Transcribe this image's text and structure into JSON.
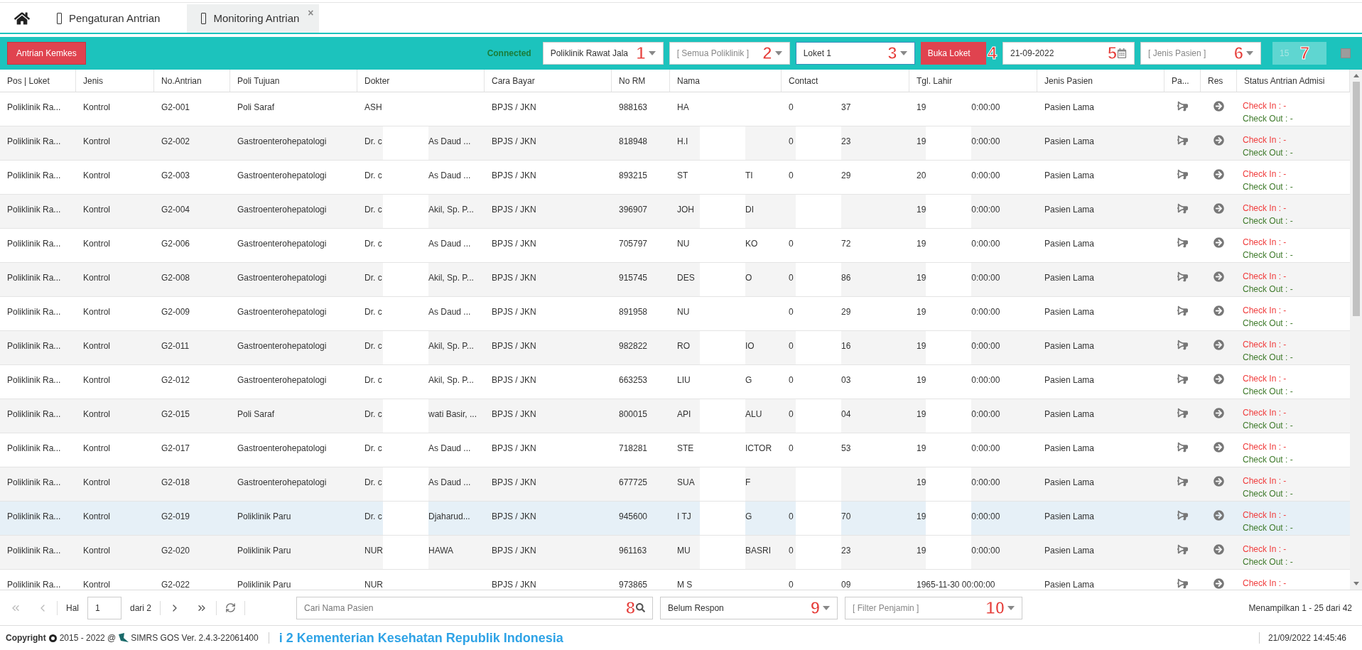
{
  "tabs": [
    {
      "kind": "home",
      "selected": false
    },
    {
      "kind": "page",
      "label": "Pengaturan Antrian",
      "selected": false
    },
    {
      "kind": "page",
      "label": "Monitoring Antrian",
      "selected": true,
      "close": "×"
    }
  ],
  "toolbar": {
    "kemkes_button": "Antrian Kemkes",
    "status": "Connected",
    "controls": [
      {
        "kind": "select",
        "value": "Poliklinik Rawat Jala",
        "marker": "1"
      },
      {
        "kind": "select",
        "placeholder": "[ Semua Poliklinik ]",
        "marker": "2"
      },
      {
        "kind": "combo",
        "value": "Loket 1",
        "focused": true,
        "marker": "3"
      },
      {
        "kind": "button",
        "label": "Buka Loket",
        "marker": "4"
      },
      {
        "kind": "date",
        "value": "21-09-2022",
        "marker": "5"
      },
      {
        "kind": "select",
        "placeholder": "[ Jenis Pasien ]",
        "marker": "6"
      },
      {
        "kind": "number",
        "value": "15",
        "disabled": true,
        "marker": "7"
      },
      {
        "kind": "checkbox",
        "disabled": true
      }
    ]
  },
  "table": {
    "columns": [
      "Pos | Loket",
      "Jenis",
      "No.Antrian",
      "Poli Tujuan",
      "Dokter",
      "Cara Bayar",
      "No RM",
      "Nama",
      "Contact",
      "Tgl. Lahir",
      "Jenis Pasien",
      "Pa...",
      "Res",
      "Status Antrian Admisi"
    ],
    "rows": [
      {
        "selected": false,
        "pos": "Poliklinik Ra...",
        "jenis": "Kontrol",
        "no": "G2-001",
        "poli": "Poli Saraf",
        "dokter": {
          "before": "ASH"
        },
        "cara": "BPJS / JKN",
        "rm": "988163",
        "nama": {
          "before": "HA"
        },
        "contact": {
          "before": "0",
          "after": "37"
        },
        "tgl": {
          "before": "19",
          "after": "0:00:00"
        },
        "pasien": "Pasien Lama",
        "check_in": "Check In : -",
        "check_out": "Check Out : -"
      },
      {
        "selected": false,
        "pos": "Poliklinik Ra...",
        "jenis": "Kontrol",
        "no": "G2-002",
        "poli": "Gastroenterohepatologi",
        "dokter": {
          "before": "Dr. c",
          "after": "As Daud ..."
        },
        "cara": "BPJS / JKN",
        "rm": "818948",
        "nama": {
          "before": "H.I"
        },
        "contact": {
          "before": "0",
          "after": "23"
        },
        "tgl": {
          "before": "19",
          "after": "0:00:00"
        },
        "pasien": "Pasien Lama",
        "check_in": "Check In : -",
        "check_out": "Check Out : -"
      },
      {
        "selected": false,
        "pos": "Poliklinik Ra...",
        "jenis": "Kontrol",
        "no": "G2-003",
        "poli": "Gastroenterohepatologi",
        "dokter": {
          "before": "Dr. c",
          "after": "As Daud ..."
        },
        "cara": "BPJS / JKN",
        "rm": "893215",
        "nama": {
          "before": "ST",
          "after": "TI"
        },
        "contact": {
          "before": "0",
          "after": "29"
        },
        "tgl": {
          "before": "20",
          "after": "0:00:00"
        },
        "pasien": "Pasien Lama",
        "check_in": "Check In : -",
        "check_out": "Check Out : -"
      },
      {
        "selected": false,
        "pos": "Poliklinik Ra...",
        "jenis": "Kontrol",
        "no": "G2-004",
        "poli": "Gastroenterohepatologi",
        "dokter": {
          "before": "Dr. c",
          "after": "Akil, Sp. P..."
        },
        "cara": "BPJS / JKN",
        "rm": "396907",
        "nama": {
          "before": "JOH",
          "after": "DI"
        },
        "tgl": {
          "before": "19",
          "after": "0:00:00"
        },
        "pasien": "Pasien Lama",
        "check_in": "Check In : -",
        "check_out": "Check Out : -"
      },
      {
        "selected": false,
        "pos": "Poliklinik Ra...",
        "jenis": "Kontrol",
        "no": "G2-006",
        "poli": "Gastroenterohepatologi",
        "dokter": {
          "before": "Dr. c",
          "after": "As Daud ..."
        },
        "cara": "BPJS / JKN",
        "rm": "705797",
        "nama": {
          "before": "NU",
          "after": "KO"
        },
        "contact": {
          "before": "0",
          "after": "72"
        },
        "tgl": {
          "before": "19",
          "after": "0:00:00"
        },
        "pasien": "Pasien Lama",
        "check_in": "Check In : -",
        "check_out": "Check Out : -"
      },
      {
        "selected": false,
        "pos": "Poliklinik Ra...",
        "jenis": "Kontrol",
        "no": "G2-008",
        "poli": "Gastroenterohepatologi",
        "dokter": {
          "before": "Dr. c",
          "after": "Akil, Sp. P..."
        },
        "cara": "BPJS / JKN",
        "rm": "915745",
        "nama": {
          "before": "DES",
          "after": "O"
        },
        "contact": {
          "before": "0",
          "after": "86"
        },
        "tgl": {
          "before": "19",
          "after": "0:00:00"
        },
        "pasien": "Pasien Lama",
        "check_in": "Check In : -",
        "check_out": "Check Out : -"
      },
      {
        "selected": false,
        "pos": "Poliklinik Ra...",
        "jenis": "Kontrol",
        "no": "G2-009",
        "poli": "Gastroenterohepatologi",
        "dokter": {
          "before": "Dr. c",
          "after": "As Daud ..."
        },
        "cara": "BPJS / JKN",
        "rm": "891958",
        "nama": {
          "before": "NU"
        },
        "contact": {
          "before": "0",
          "after": "29"
        },
        "tgl": {
          "before": "19",
          "after": "0:00:00"
        },
        "pasien": "Pasien Lama",
        "check_in": "Check In : -",
        "check_out": "Check Out : -"
      },
      {
        "selected": false,
        "pos": "Poliklinik Ra...",
        "jenis": "Kontrol",
        "no": "G2-011",
        "poli": "Gastroenterohepatologi",
        "dokter": {
          "before": "Dr. c",
          "after": "Akil, Sp. P..."
        },
        "cara": "BPJS / JKN",
        "rm": "982822",
        "nama": {
          "before": "RO",
          "after": "IO"
        },
        "contact": {
          "before": "0",
          "after": "16"
        },
        "tgl": {
          "before": "19",
          "after": "0:00:00"
        },
        "pasien": "Pasien Lama",
        "check_in": "Check In : -",
        "check_out": "Check Out : -"
      },
      {
        "selected": false,
        "pos": "Poliklinik Ra...",
        "jenis": "Kontrol",
        "no": "G2-012",
        "poli": "Gastroenterohepatologi",
        "dokter": {
          "before": "Dr. c",
          "after": "Akil, Sp. P..."
        },
        "cara": "BPJS / JKN",
        "rm": "663253",
        "nama": {
          "before": "LIU",
          "after": "G"
        },
        "contact": {
          "before": "0",
          "after": "03"
        },
        "tgl": {
          "before": "19",
          "after": "0:00:00"
        },
        "pasien": "Pasien Lama",
        "check_in": "Check In : -",
        "check_out": "Check Out : -"
      },
      {
        "selected": false,
        "pos": "Poliklinik Ra...",
        "jenis": "Kontrol",
        "no": "G2-015",
        "poli": "Poli Saraf",
        "dokter": {
          "before": "Dr. c",
          "after": "wati Basir, ..."
        },
        "cara": "BPJS / JKN",
        "rm": "800015",
        "nama": {
          "before": "API",
          "after": "ALU"
        },
        "contact": {
          "before": "0",
          "after": "04"
        },
        "tgl": {
          "before": "19",
          "after": "0:00:00"
        },
        "pasien": "Pasien Lama",
        "check_in": "Check In : -",
        "check_out": "Check Out : -"
      },
      {
        "selected": false,
        "pos": "Poliklinik Ra...",
        "jenis": "Kontrol",
        "no": "G2-017",
        "poli": "Gastroenterohepatologi",
        "dokter": {
          "before": "Dr. c",
          "after": "As Daud ..."
        },
        "cara": "BPJS / JKN",
        "rm": "718281",
        "nama": {
          "before": "STE",
          "after": "ICTOR"
        },
        "contact": {
          "before": "0",
          "after": "53"
        },
        "tgl": {
          "before": "19",
          "after": "0:00:00"
        },
        "pasien": "Pasien Lama",
        "check_in": "Check In : -",
        "check_out": "Check Out : -"
      },
      {
        "selected": false,
        "pos": "Poliklinik Ra...",
        "jenis": "Kontrol",
        "no": "G2-018",
        "poli": "Gastroenterohepatologi",
        "dokter": {
          "before": "Dr. c",
          "after": "As Daud ..."
        },
        "cara": "BPJS / JKN",
        "rm": "677725",
        "nama": {
          "before": "SUA",
          "after": "F"
        },
        "tgl": {
          "before": "19",
          "after": "0:00:00"
        },
        "pasien": "Pasien Lama",
        "check_in": "Check In : -",
        "check_out": "Check Out : -"
      },
      {
        "selected": true,
        "pos": "Poliklinik Ra...",
        "jenis": "Kontrol",
        "no": "G2-019",
        "poli": "Poliklinik Paru",
        "dokter": {
          "before": "Dr. c",
          "after": "Djaharud..."
        },
        "cara": "BPJS / JKN",
        "rm": "945600",
        "nama": {
          "before": "I TJ",
          "after": "G"
        },
        "contact": {
          "before": "0",
          "after": "70"
        },
        "tgl": {
          "before": "19",
          "after": "0:00:00"
        },
        "pasien": "Pasien Lama",
        "check_in": "Check In : -",
        "check_out": "Check Out : -"
      },
      {
        "selected": false,
        "pos": "Poliklinik Ra...",
        "jenis": "Kontrol",
        "no": "G2-020",
        "poli": "Poliklinik Paru",
        "dokter": {
          "before": "NUR",
          "after": "HAWA"
        },
        "cara": "BPJS / JKN",
        "rm": "961163",
        "nama": {
          "before": "MU",
          "after": "BASRI"
        },
        "contact": {
          "before": "0",
          "after": "23"
        },
        "tgl": {
          "before": "19",
          "after": "0:00:00"
        },
        "pasien": "Pasien Lama",
        "check_in": "Check In : -",
        "check_out": "Check Out : -"
      },
      {
        "selected": false,
        "pos": "Poliklinik Ra...",
        "jenis": "Kontrol",
        "no": "G2-022",
        "poli": "Poliklinik Paru",
        "dokter": {
          "before": "NUR"
        },
        "cara": "BPJS / JKN",
        "rm": "973865",
        "nama": {
          "before": "M S"
        },
        "contact": {
          "before": "0",
          "after": "09"
        },
        "tgl": "1965-11-30 00:00:00",
        "pasien": "Pasien Lama",
        "check_in": "Check In : -"
      }
    ]
  },
  "pager": {
    "page_label": "Hal",
    "page": "1",
    "of": "dari 2",
    "can_prev": false,
    "can_next": true
  },
  "search": {
    "placeholder": "Cari Nama Pasien",
    "marker": "8"
  },
  "filters": [
    {
      "value": "Belum Respon",
      "marker": "9"
    },
    {
      "placeholder": "[ Filter Penjamin ]",
      "marker": "10"
    }
  ],
  "summary": "Menampilkan 1 - 25 dari 42",
  "status_bar": {
    "copyright_label": "Copyright",
    "years": "2015 - 2022 @",
    "version": "SIMRS GOS Ver. 2.4.3-22061400",
    "ticker": "i 2 Kementerian Kesehatan Republik Indonesia",
    "datetime": "21/09/2022 14:45:46"
  }
}
